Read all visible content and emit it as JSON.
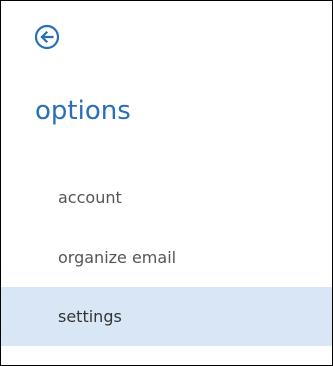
{
  "colors": {
    "accent": "#2a6fb6",
    "text_muted": "#555555",
    "selected_background": "#d9e6f6"
  },
  "header": {
    "back_icon": "circle-arrow-left-icon",
    "title": "options"
  },
  "menu": {
    "items": [
      {
        "label": "account",
        "selected": false
      },
      {
        "label": "organize email",
        "selected": false
      },
      {
        "label": "settings",
        "selected": true
      }
    ]
  }
}
